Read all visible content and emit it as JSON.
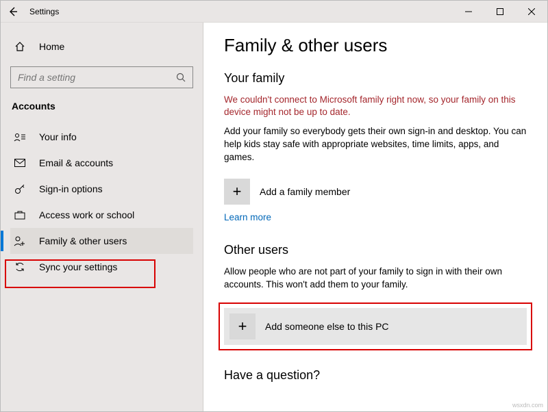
{
  "titlebar": {
    "title": "Settings"
  },
  "sidebar": {
    "home": "Home",
    "search_placeholder": "Find a setting",
    "category": "Accounts",
    "items": [
      {
        "label": "Your info"
      },
      {
        "label": "Email & accounts"
      },
      {
        "label": "Sign-in options"
      },
      {
        "label": "Access work or school"
      },
      {
        "label": "Family & other users"
      },
      {
        "label": "Sync your settings"
      }
    ]
  },
  "content": {
    "title": "Family & other users",
    "family_heading": "Your family",
    "family_warning": "We couldn't connect to Microsoft family right now, so your family on this device might not be up to date.",
    "family_para": "Add your family so everybody gets their own sign-in and desktop. You can help kids stay safe with appropriate websites, time limits, apps, and games.",
    "add_family_label": "Add a family member",
    "learn_more": "Learn more",
    "other_heading": "Other users",
    "other_para": "Allow people who are not part of your family to sign in with their own accounts. This won't add them to your family.",
    "add_other_label": "Add someone else to this PC",
    "question_heading": "Have a question?"
  },
  "watermark": "wsxdn.com"
}
